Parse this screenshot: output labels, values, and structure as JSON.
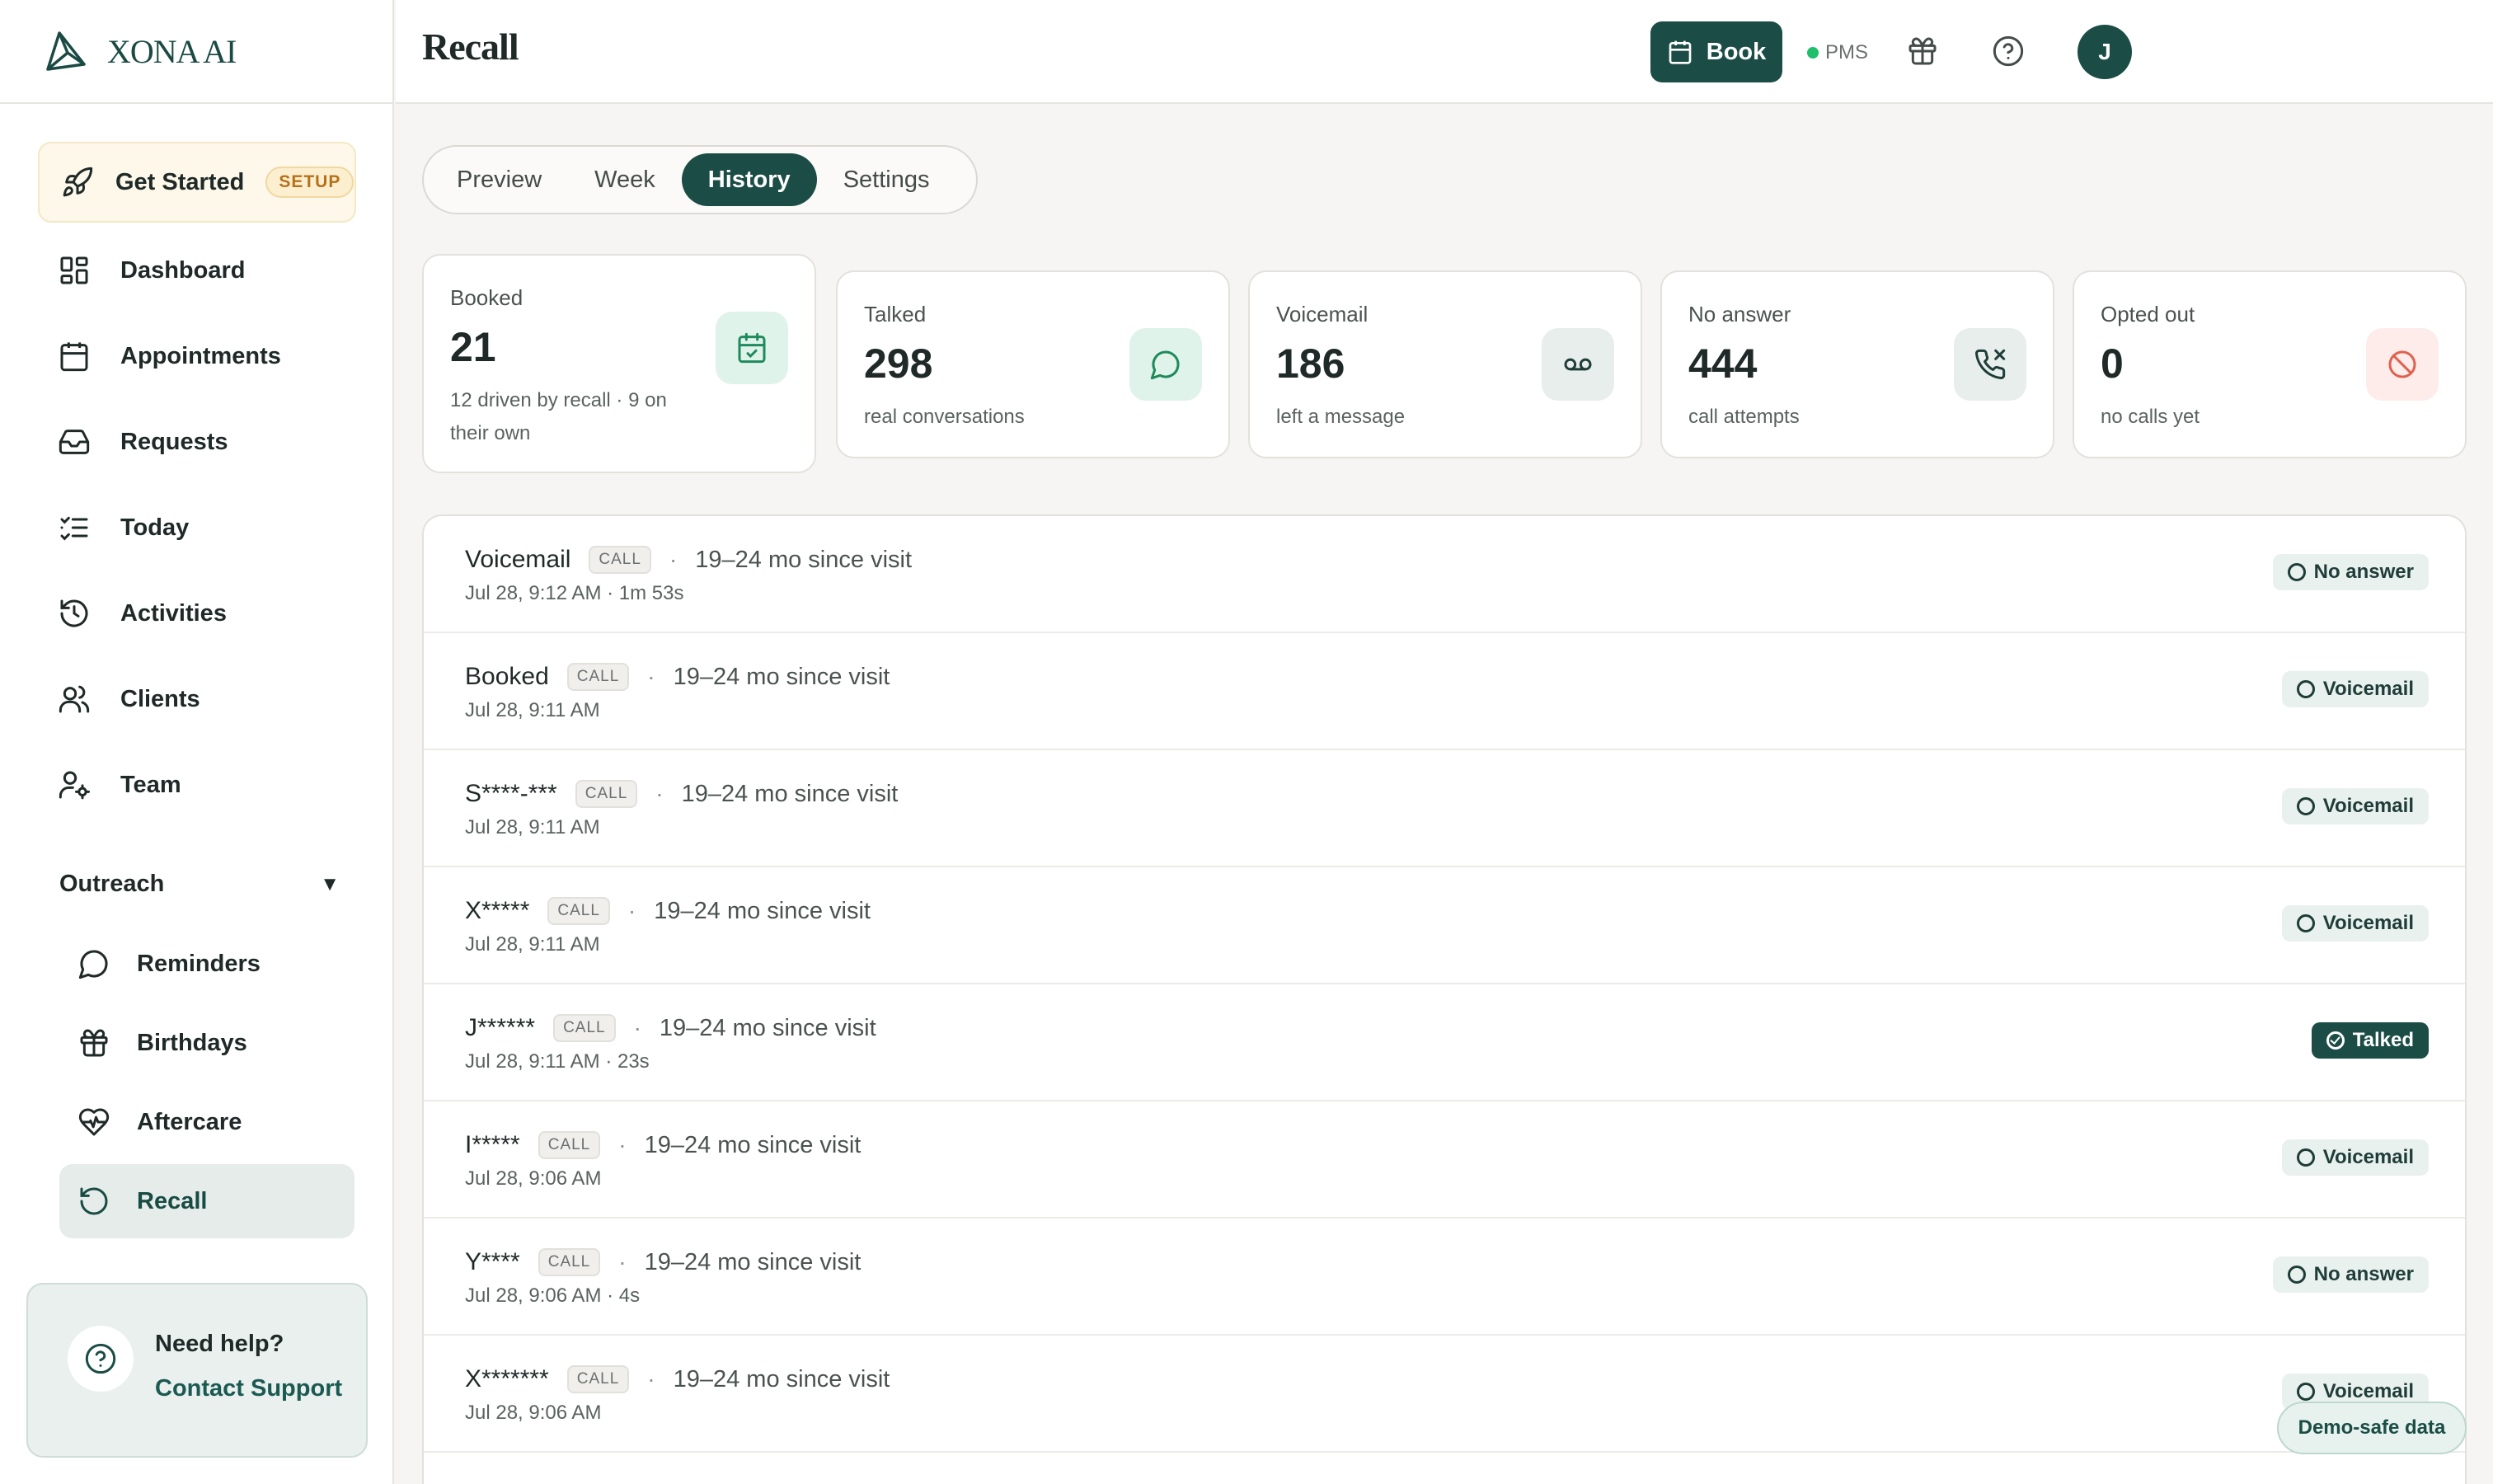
{
  "brand": {
    "name": "XONA AI"
  },
  "sidebar": {
    "get_started": {
      "label": "Get Started",
      "badge": "SETUP"
    },
    "items": [
      {
        "label": "Dashboard",
        "icon": "dashboard-icon"
      },
      {
        "label": "Appointments",
        "icon": "calendar-icon"
      },
      {
        "label": "Requests",
        "icon": "inbox-icon"
      },
      {
        "label": "Today",
        "icon": "checklist-icon"
      },
      {
        "label": "Activities",
        "icon": "history-icon"
      },
      {
        "label": "Clients",
        "icon": "users-icon"
      },
      {
        "label": "Team",
        "icon": "user-gear-icon"
      }
    ],
    "outreach": {
      "label": "Outreach",
      "caret": "▼",
      "items": [
        {
          "label": "Reminders",
          "icon": "chat-bubble-icon"
        },
        {
          "label": "Birthdays",
          "icon": "gift-icon"
        },
        {
          "label": "Aftercare",
          "icon": "heart-pulse-icon"
        },
        {
          "label": "Recall",
          "icon": "rotate-ccw-icon",
          "active": true
        }
      ]
    },
    "help": {
      "title": "Need help?",
      "link": "Contact Support"
    }
  },
  "header": {
    "title": "Recall",
    "book_label": "Book",
    "pms_label": "PMS",
    "pms_status_color": "#1fbf6c",
    "avatar_initial": "J"
  },
  "tabs": [
    {
      "label": "Preview",
      "active": false
    },
    {
      "label": "Week",
      "active": false
    },
    {
      "label": "History",
      "active": true
    },
    {
      "label": "Settings",
      "active": false
    }
  ],
  "stats": [
    {
      "label": "Booked",
      "value": "21",
      "sub": "12 driven by recall · 9 on their own",
      "icon": "calendar-check-icon",
      "icon_bg": "#dff3ea",
      "icon_color": "#1f8a5b"
    },
    {
      "label": "Talked",
      "value": "298",
      "sub": "real conversations",
      "icon": "chat-bubble-icon",
      "icon_bg": "#dff3ea",
      "icon_color": "#1f8a5b"
    },
    {
      "label": "Voicemail",
      "value": "186",
      "sub": "left a message",
      "icon": "voicemail-icon",
      "icon_bg": "#e7eeec",
      "icon_color": "#1f3d38"
    },
    {
      "label": "No answer",
      "value": "444",
      "sub": "call attempts",
      "icon": "phone-missed-icon",
      "icon_bg": "#e7eeec",
      "icon_color": "#1f3d38"
    },
    {
      "label": "Opted out",
      "value": "0",
      "sub": "no calls yet",
      "icon": "ban-icon",
      "icon_bg": "#fdecea",
      "icon_color": "#e0604f"
    }
  ],
  "history": [
    {
      "name": "Voicemail",
      "tag": "CALL",
      "since": "19–24 mo since visit",
      "meta": "Jul 28, 9:12 AM · 1m 53s",
      "status": "No answer"
    },
    {
      "name": "Booked",
      "tag": "CALL",
      "since": "19–24 mo since visit",
      "meta": "Jul 28, 9:11 AM",
      "status": "Voicemail"
    },
    {
      "name": "S****-***",
      "tag": "CALL",
      "since": "19–24 mo since visit",
      "meta": "Jul 28, 9:11 AM",
      "status": "Voicemail"
    },
    {
      "name": "X*****",
      "tag": "CALL",
      "since": "19–24 mo since visit",
      "meta": "Jul 28, 9:11 AM",
      "status": "Voicemail"
    },
    {
      "name": "J******",
      "tag": "CALL",
      "since": "19–24 mo since visit",
      "meta": "Jul 28, 9:11 AM · 23s",
      "status": "Talked"
    },
    {
      "name": "I*****",
      "tag": "CALL",
      "since": "19–24 mo since visit",
      "meta": "Jul 28, 9:06 AM",
      "status": "Voicemail"
    },
    {
      "name": "Y****",
      "tag": "CALL",
      "since": "19–24 mo since visit",
      "meta": "Jul 28, 9:06 AM · 4s",
      "status": "No answer"
    },
    {
      "name": "X*******",
      "tag": "CALL",
      "since": "19–24 mo since visit",
      "meta": "Jul 28, 9:06 AM",
      "status": "Voicemail"
    }
  ],
  "separator": "·",
  "demo_pill": "Demo-safe data"
}
